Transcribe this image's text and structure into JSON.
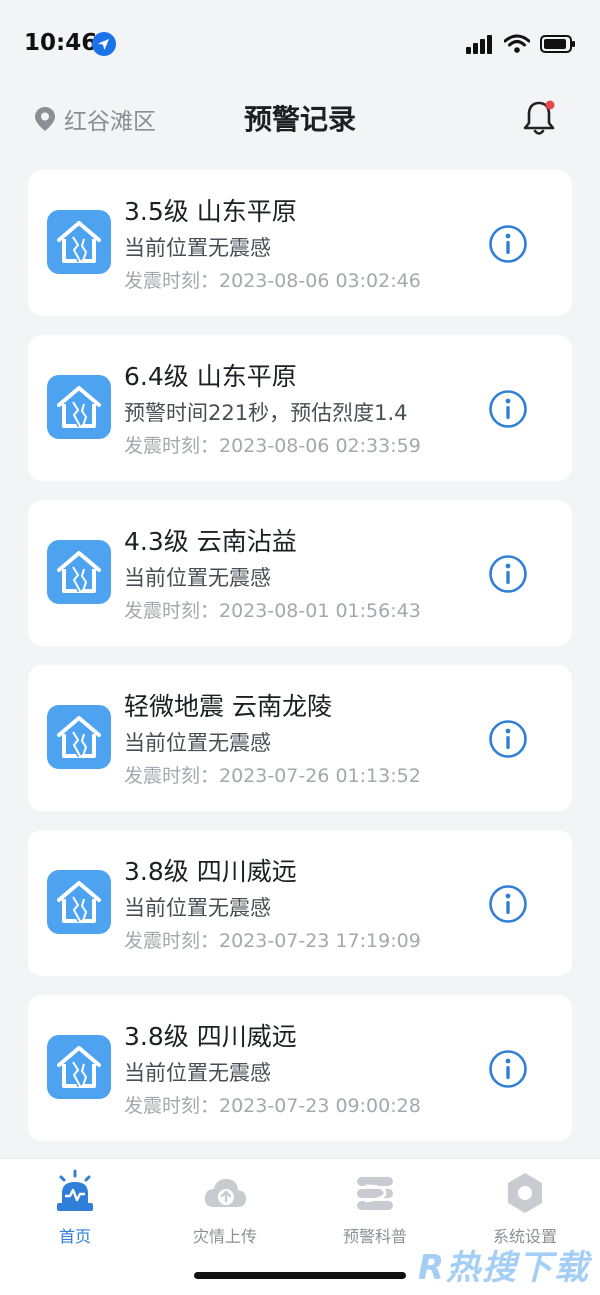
{
  "status_bar": {
    "time": "10:46"
  },
  "header": {
    "location": "红谷滩区",
    "title": "预警记录"
  },
  "records": [
    {
      "title": "3.5级 山东平原",
      "desc": "当前位置无震感",
      "time": "发震时刻：2023-08-06 03:02:46"
    },
    {
      "title": "6.4级 山东平原",
      "desc": "预警时间221秒，预估烈度1.4",
      "time": "发震时刻：2023-08-06 02:33:59"
    },
    {
      "title": "4.3级 云南沾益",
      "desc": "当前位置无震感",
      "time": "发震时刻：2023-08-01 01:56:43"
    },
    {
      "title": "轻微地震 云南龙陵",
      "desc": "当前位置无震感",
      "time": "发震时刻：2023-07-26 01:13:52"
    },
    {
      "title": "3.8级 四川威远",
      "desc": "当前位置无震感",
      "time": "发震时刻：2023-07-23 17:19:09"
    },
    {
      "title": "3.8级 四川威远",
      "desc": "当前位置无震感",
      "time": "发震时刻：2023-07-23 09:00:28"
    }
  ],
  "tabs": [
    {
      "label": "首页",
      "icon": "alarm-icon",
      "active": true
    },
    {
      "label": "灾情上传",
      "icon": "cloud-upload-icon",
      "active": false
    },
    {
      "label": "预警科普",
      "icon": "book-icon",
      "active": false
    },
    {
      "label": "系统设置",
      "icon": "settings-hexagon-icon",
      "active": false
    }
  ],
  "watermark": "R热搜下载",
  "colors": {
    "accent": "#2f7fd8",
    "icon_bg": "#4da3f0",
    "bell_dot": "#e5484d"
  }
}
